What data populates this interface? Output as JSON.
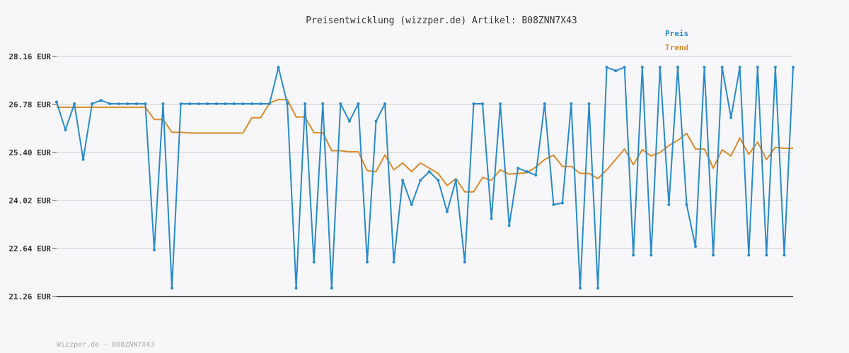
{
  "chart_data": {
    "type": "line",
    "title": "Preisentwicklung (wizzper.de) Artikel: B08ZNN7X43",
    "footer": "Wizzper.de - B08ZNN7X43",
    "ylim": [
      21.26,
      28.16
    ],
    "y_ticks": [
      "28.16 EUR",
      "26.78 EUR",
      "25.40 EUR",
      "24.02 EUR",
      "22.64 EUR",
      "21.26 EUR"
    ],
    "y_tick_values": [
      28.16,
      26.78,
      25.4,
      24.02,
      22.64,
      21.26
    ],
    "grid": true,
    "legend_position": "top-right",
    "x_count": 84,
    "series": [
      {
        "name": "Preis",
        "color": "#2a8ac9",
        "values": [
          26.85,
          26.05,
          26.8,
          25.2,
          26.8,
          26.9,
          26.8,
          26.8,
          26.8,
          26.8,
          26.8,
          22.6,
          26.8,
          21.5,
          26.8,
          26.8,
          26.8,
          26.8,
          26.8,
          26.8,
          26.8,
          26.8,
          26.8,
          26.8,
          26.8,
          27.85,
          26.8,
          21.5,
          26.8,
          22.25,
          26.8,
          21.5,
          26.8,
          26.3,
          26.8,
          22.25,
          26.3,
          26.8,
          22.25,
          24.6,
          23.9,
          24.6,
          24.85,
          24.6,
          23.7,
          24.6,
          22.25,
          26.8,
          26.8,
          23.5,
          26.8,
          23.3,
          24.95,
          24.85,
          24.75,
          26.8,
          23.9,
          23.95,
          26.8,
          21.5,
          26.8,
          21.5,
          27.85,
          27.75,
          27.85,
          22.45,
          27.85,
          22.45,
          27.85,
          23.9,
          27.85,
          23.9,
          22.7,
          27.85,
          22.45,
          27.85,
          26.4,
          27.85,
          22.45,
          27.85,
          22.45,
          27.85,
          22.45,
          27.85
        ]
      },
      {
        "name": "Trend",
        "color": "#d98b2b",
        "values": [
          26.7,
          26.7,
          26.7,
          26.7,
          26.7,
          26.7,
          26.7,
          26.7,
          26.7,
          26.7,
          26.7,
          26.35,
          26.35,
          25.98,
          25.98,
          25.96,
          25.96,
          25.96,
          25.96,
          25.96,
          25.96,
          25.96,
          26.4,
          26.4,
          26.82,
          26.92,
          26.92,
          26.42,
          26.42,
          25.97,
          25.97,
          25.45,
          25.45,
          25.42,
          25.42,
          24.88,
          24.85,
          25.33,
          24.9,
          25.1,
          24.85,
          25.1,
          24.95,
          24.8,
          24.45,
          24.65,
          24.27,
          24.27,
          24.68,
          24.6,
          24.9,
          24.78,
          24.8,
          24.82,
          24.98,
          25.2,
          25.32,
          25.0,
          25.0,
          24.8,
          24.8,
          24.65,
          24.9,
          25.2,
          25.5,
          25.05,
          25.48,
          25.3,
          25.4,
          25.6,
          25.75,
          25.95,
          25.5,
          25.5,
          24.95,
          25.48,
          25.3,
          25.82,
          25.35,
          25.7,
          25.2,
          25.55,
          25.52,
          25.52
        ]
      }
    ]
  }
}
